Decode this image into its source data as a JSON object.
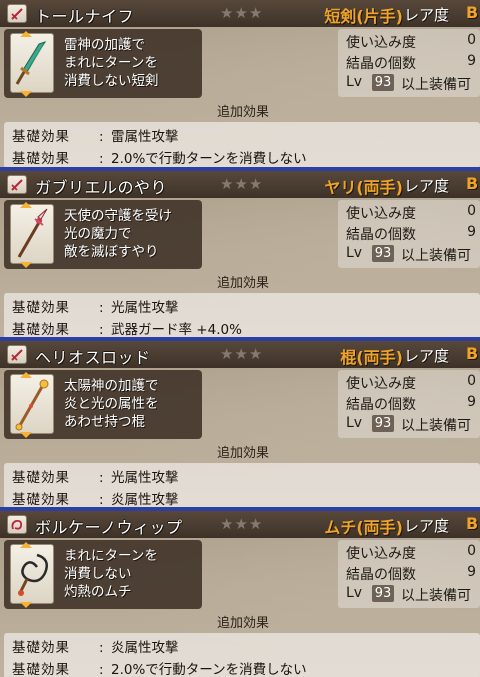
{
  "weapons": [
    {
      "name": "トールナイフ",
      "stars": "★★★",
      "type": "短剣(片手)",
      "rarity_label": "レア度",
      "rarity": "B",
      "description": "雷神の加護で\nまれにターンを\n消費しない短剣",
      "stats": {
        "usage_label": "使い込み度",
        "usage_value": "0",
        "crystals_label": "結晶の個数",
        "crystals_value": "9",
        "lv_label": "Lv",
        "lv_value": "93",
        "lv_suffix": "以上装備可"
      },
      "additional_label": "追加効果",
      "effects": [
        {
          "label": "基礎効果",
          "value": "雷属性攻撃"
        },
        {
          "label": "基礎効果",
          "value": "2.0%で行動ターンを消費しない"
        }
      ],
      "icon": "dagger-icon"
    },
    {
      "name": "ガブリエルのやり",
      "stars": "★★★",
      "type": "ヤリ(両手)",
      "rarity_label": "レア度",
      "rarity": "B",
      "description": "天使の守護を受け\n光の魔力で\n敵を滅ぼすやり",
      "stats": {
        "usage_label": "使い込み度",
        "usage_value": "0",
        "crystals_label": "結晶の個数",
        "crystals_value": "9",
        "lv_label": "Lv",
        "lv_value": "93",
        "lv_suffix": "以上装備可"
      },
      "additional_label": "追加効果",
      "effects": [
        {
          "label": "基礎効果",
          "value": "光属性攻撃"
        },
        {
          "label": "基礎効果",
          "value": "武器ガード率 +4.0%"
        }
      ],
      "icon": "spear-icon"
    },
    {
      "name": "ヘリオスロッド",
      "stars": "★★★",
      "type": "棍(両手)",
      "rarity_label": "レア度",
      "rarity": "B",
      "description": "太陽神の加護で\n炎と光の属性を\nあわせ持つ棍",
      "stats": {
        "usage_label": "使い込み度",
        "usage_value": "0",
        "crystals_label": "結晶の個数",
        "crystals_value": "9",
        "lv_label": "Lv",
        "lv_value": "93",
        "lv_suffix": "以上装備可"
      },
      "additional_label": "追加効果",
      "effects": [
        {
          "label": "基礎効果",
          "value": "光属性攻撃"
        },
        {
          "label": "基礎効果",
          "value": "炎属性攻撃"
        }
      ],
      "icon": "rod-icon"
    },
    {
      "name": "ボルケーノウィップ",
      "stars": "★★★",
      "type": "ムチ(両手)",
      "rarity_label": "レア度",
      "rarity": "B",
      "description": "まれにターンを\n消費しない\n灼熱のムチ",
      "stats": {
        "usage_label": "使い込み度",
        "usage_value": "0",
        "crystals_label": "結晶の個数",
        "crystals_value": "9",
        "lv_label": "Lv",
        "lv_value": "93",
        "lv_suffix": "以上装備可"
      },
      "additional_label": "追加効果",
      "effects": [
        {
          "label": "基礎効果",
          "value": "炎属性攻撃"
        },
        {
          "label": "基礎効果",
          "value": "2.0%で行動ターンを消費しない"
        }
      ],
      "icon": "whip-icon"
    }
  ],
  "colors": {
    "separator": "#2c3fa3",
    "type_text": "#f0a32a",
    "arrow": "#f6b235"
  }
}
